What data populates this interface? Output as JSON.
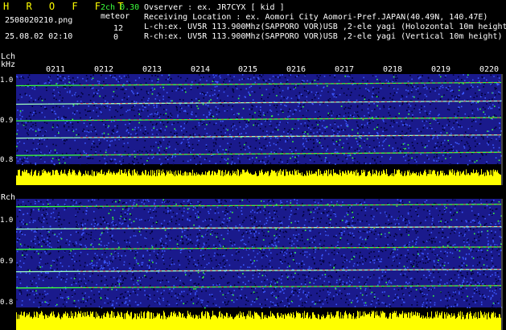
{
  "header": {
    "app_title": "H R O F F T",
    "version": "2ch 0.30",
    "meteor_label": "meteor",
    "filename": "2508020210.png",
    "timestamp": "25.08.02 02:10",
    "count_l": "12",
    "count_r": "0",
    "info_lines": [
      "Ovserver             : ex. JR7CYX [ kid ]",
      "Receiving Location : ex. Aomori City Aomori-Pref.JAPAN(40.49N, 140.47E)",
      "L-ch:ex. UV5R 113.900Mhz(SAPPORO VOR)USB ,2-ele yagi (Holozontal 10m height)",
      "R-ch:ex. UV5R 113.900Mhz(SAPPORO VOR)USB ,2-ele yagi (Vertical 10m height)"
    ]
  },
  "time_labels": [
    "0211",
    "0212",
    "0213",
    "0214",
    "0215",
    "0216",
    "0217",
    "0218",
    "0219",
    "0220"
  ],
  "left_channel": {
    "label": "Lch",
    "unit": "kHz",
    "ticks": [
      "1.0",
      "0.9",
      "0.8"
    ],
    "lines_khz": [
      0.995,
      0.948,
      0.906,
      0.862,
      0.818
    ]
  },
  "right_channel": {
    "label": "Rch",
    "ticks": [
      "1.0",
      "0.9",
      "0.8"
    ],
    "lines_khz": [
      1.04,
      0.985,
      0.935,
      0.88,
      0.84
    ]
  },
  "colors": {
    "background": "#000000",
    "noise_dark": "#1a1a8c",
    "noise_light": "#3c5aff",
    "signal_green": "#3cff3c",
    "signal_red": "#ff3c3c",
    "signal_yellow": "#ffff00",
    "text_yellow": "#ffff00",
    "text_green": "#3cff3c"
  }
}
